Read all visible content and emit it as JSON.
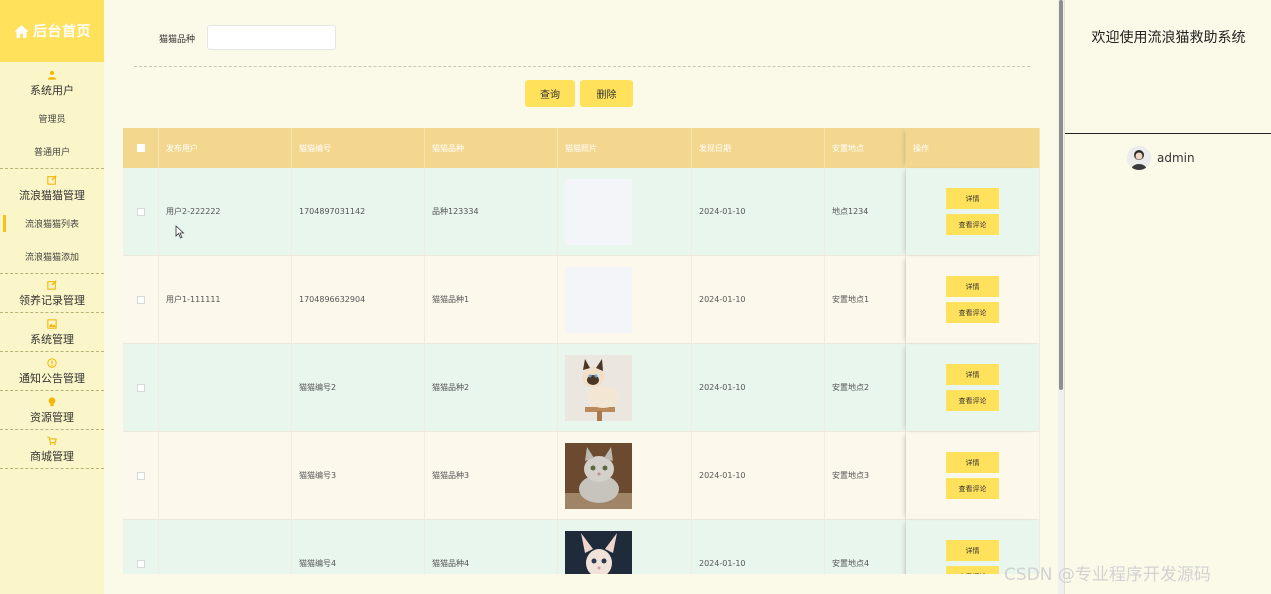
{
  "logo": {
    "text": "后台首页",
    "icon": "home-icon"
  },
  "sidebar": {
    "system_user": {
      "label": "系统用户",
      "icon": "user-icon",
      "subs": [
        "管理员",
        "普通用户"
      ]
    },
    "cat_mgmt": {
      "label": "流浪猫猫管理",
      "icon": "edit-icon",
      "subs": [
        "流浪猫猫列表",
        "流浪猫猫添加"
      ]
    },
    "adopt": {
      "label": "领养记录管理",
      "icon": "edit-icon"
    },
    "system": {
      "label": "系统管理",
      "icon": "image-icon"
    },
    "notice": {
      "label": "通知公告管理",
      "icon": "info-icon"
    },
    "resource": {
      "label": "资源管理",
      "icon": "bulb-icon"
    },
    "shop": {
      "label": "商城管理",
      "icon": "cart-icon"
    }
  },
  "search": {
    "label": "猫猫品种",
    "value": "",
    "placeholder": ""
  },
  "buttons": {
    "query": "查询",
    "delete": "删除"
  },
  "table": {
    "headers": [
      "发布用户",
      "猫猫编号",
      "猫猫品种",
      "猫猫照片",
      "发现日期",
      "安置地点",
      "操作"
    ],
    "action_detail": "详情",
    "action_comments": "查看评论",
    "rows": [
      {
        "user": "用户2-222222",
        "code": "1704897031142",
        "breed": "品种123334",
        "photo": "blank",
        "date": "2024-01-10",
        "place": "地点1234"
      },
      {
        "user": "用户1-111111",
        "code": "1704896632904",
        "breed": "猫猫品种1",
        "photo": "blank",
        "date": "2024-01-10",
        "place": "安置地点1"
      },
      {
        "user": "",
        "code": "猫猫编号2",
        "breed": "猫猫品种2",
        "photo": "siamese-cat",
        "date": "2024-01-10",
        "place": "安置地点2"
      },
      {
        "user": "",
        "code": "猫猫编号3",
        "breed": "猫猫品种3",
        "photo": "fluffy-kitten",
        "date": "2024-01-10",
        "place": "安置地点3"
      },
      {
        "user": "",
        "code": "猫猫编号4",
        "breed": "猫猫品种4",
        "photo": "sphynx-kitten",
        "date": "2024-01-10",
        "place": "安置地点4"
      }
    ]
  },
  "right": {
    "welcome": "欢迎使用流浪猫救助系统",
    "username": "admin"
  },
  "watermark": "CSDN @专业程序开发源码",
  "colors": {
    "accent": "#ffe15c",
    "table_header": "#f4d78e",
    "sidebar_bg": "#fbf6c9",
    "row_even": "#e9f6ee",
    "row_odd": "#fcf8ec",
    "icon_orange": "#f5b400"
  }
}
